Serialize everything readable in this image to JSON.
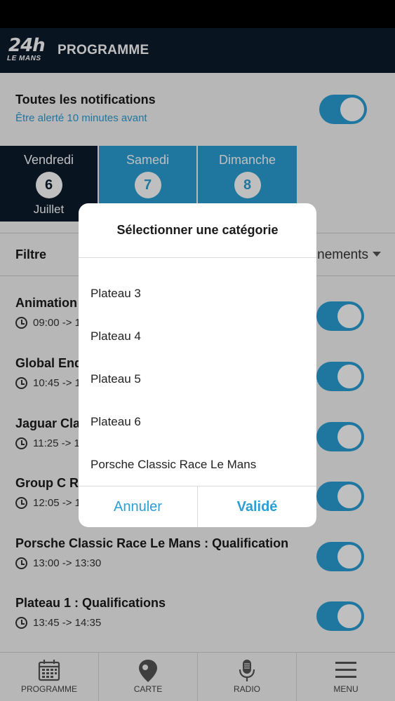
{
  "appbar": {
    "logo_main": "24h",
    "logo_sub": "LE MANS",
    "title": "PROGRAMME"
  },
  "notifications": {
    "title": "Toutes les notifications",
    "subtitle": "Être alerté 10 minutes avant",
    "enabled": true
  },
  "days": [
    {
      "name": "Vendredi",
      "number": "6",
      "month": "Juillet",
      "selected": true
    },
    {
      "name": "Samedi",
      "number": "7",
      "month": "",
      "selected": false
    },
    {
      "name": "Dimanche",
      "number": "8",
      "month": "",
      "selected": false
    }
  ],
  "filter": {
    "label": "Filtre",
    "value": "nements"
  },
  "events": [
    {
      "title": "Animation :",
      "time": "09:00 -> 1",
      "enabled": true
    },
    {
      "title": "Global Endu",
      "time": "10:45 -> 1",
      "enabled": true
    },
    {
      "title": "Jaguar Clas",
      "time": "11:25 -> 1",
      "enabled": true
    },
    {
      "title": "Group C Ra",
      "time": "12:05 -> 1",
      "enabled": true
    },
    {
      "title": "Porsche Classic Race Le Mans : Qualification",
      "time": "13:00 -> 13:30",
      "enabled": true
    },
    {
      "title": "Plateau 1 : Qualifications",
      "time": "13:45 -> 14:35",
      "enabled": true
    }
  ],
  "dialog": {
    "title": "Sélectionner une catégorie",
    "options": [
      "Plateau 3",
      "Plateau 4",
      "Plateau 5",
      "Plateau 6",
      "Porsche Classic Race Le Mans"
    ],
    "cancel": "Annuler",
    "confirm": "Validé"
  },
  "tabbar": [
    {
      "label": "PROGRAMME",
      "icon": "calendar-icon"
    },
    {
      "label": "CARTE",
      "icon": "map-pin-icon"
    },
    {
      "label": "RADIO",
      "icon": "microphone-icon"
    },
    {
      "label": "MENU",
      "icon": "hamburger-icon"
    }
  ],
  "colors": {
    "navy": "#0d1b2c",
    "accent": "#2a9fd6"
  }
}
